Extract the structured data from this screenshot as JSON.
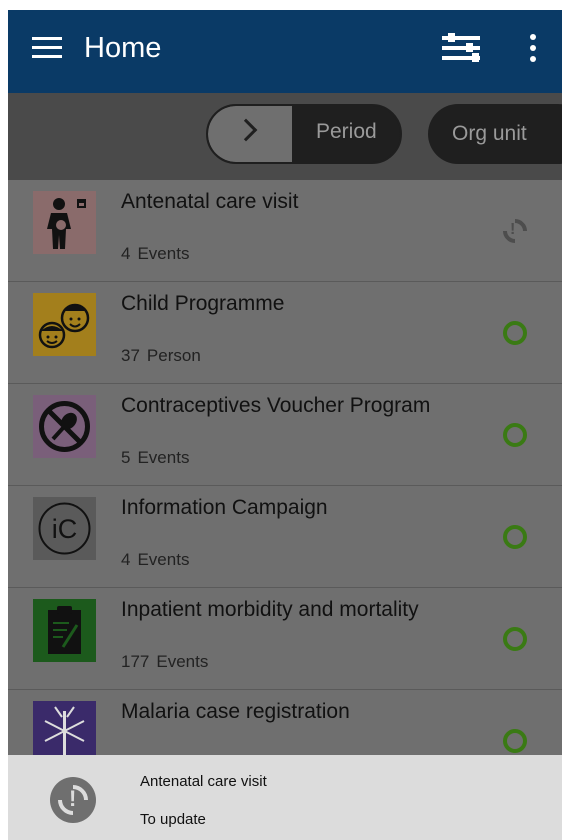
{
  "toolbar": {
    "title": "Home",
    "menu_icon": "menu-icon",
    "filter_icon": "filter-icon",
    "more_icon": "more-vert-icon",
    "color": "#0a3a66"
  },
  "filters": {
    "period_label": "Period",
    "orgunit_label": "Org unit"
  },
  "programs": [
    {
      "name": "Antenatal care visit",
      "count": "4",
      "unit": "Events",
      "thumb_color": "#8a6b6b",
      "icon": "pregnant-woman-icon",
      "sync_state": "sync-error"
    },
    {
      "name": "Child Programme",
      "count": "37",
      "unit": "Person",
      "thumb_color": "#a37f1c",
      "icon": "children-faces-icon",
      "sync_state": "synced"
    },
    {
      "name": "Contraceptives Voucher Program",
      "count": "5",
      "unit": "Events",
      "thumb_color": "#7a5f7a",
      "icon": "no-contraceptive-icon",
      "sync_state": "synced"
    },
    {
      "name": "Information Campaign",
      "count": "4",
      "unit": "Events",
      "thumb_color": "#5a5a5a",
      "icon": "ic-logo-icon",
      "sync_state": "synced"
    },
    {
      "name": "Inpatient morbidity and mortality",
      "count": "177",
      "unit": "Events",
      "thumb_color": "#1c5a1c",
      "icon": "clipboard-icon",
      "sync_state": "synced"
    },
    {
      "name": "Malaria case registration",
      "count": "",
      "unit": "",
      "thumb_color": "#3a2a6a",
      "icon": "mosquito-icon",
      "sync_state": "synced"
    }
  ],
  "snackbar": {
    "title": "Antenatal care visit",
    "subtitle": "To update",
    "icon": "sync-error-icon"
  }
}
